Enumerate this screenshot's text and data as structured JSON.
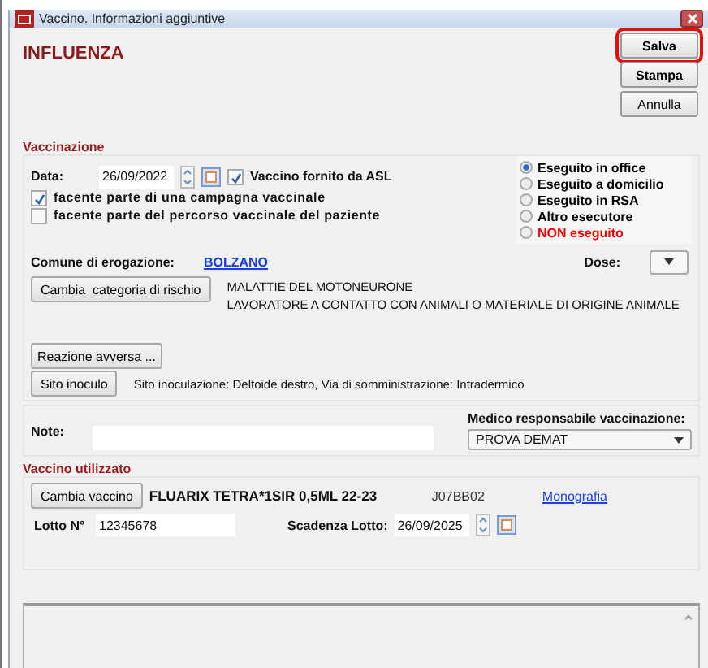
{
  "window": {
    "title": "Vaccino. Informazioni aggiuntive"
  },
  "heading": "INFLUENZA",
  "buttons": [
    {
      "label": "Salva",
      "highlighted": true
    },
    {
      "label": "Stampa",
      "highlighted": false
    },
    {
      "label": "Annulla",
      "highlighted": false
    }
  ],
  "vaccinazione": {
    "title": "Vaccinazione",
    "date_label": "Data:",
    "date": "26/09/2022",
    "asl": {
      "label": "Vaccino fornito da ASL",
      "checked": true
    },
    "checkboxes": [
      {
        "label": "facente parte di una campagna vaccinale",
        "checked": true
      },
      {
        "label": "facente parte del percorso vaccinale del paziente",
        "checked": false
      }
    ],
    "executor_options": [
      {
        "label": "Eseguito in office",
        "selected": true,
        "color": "#000000"
      },
      {
        "label": "Eseguito a domicilio",
        "selected": false,
        "color": "#000000"
      },
      {
        "label": "Eseguito in RSA",
        "selected": false,
        "color": "#000000"
      },
      {
        "label": "Altro esecutore",
        "selected": false,
        "color": "#000000"
      },
      {
        "label": "NON eseguito",
        "selected": false,
        "color": "#ff0000"
      }
    ],
    "comune_label": "Comune di erogazione:",
    "comune": "BOLZANO",
    "dose_label": "Dose:",
    "risk_button": "Cambia  categoria di rischio",
    "risk_lines": [
      "MALATTIE DEL MOTONEURONE",
      "LAVORATORE A CONTATTO CON ANIMALI O MATERIALE DI ORIGINE ANIMALE"
    ],
    "reaction_button": "Reazione avversa ...",
    "site_button": "Sito inoculo",
    "site_text": "Sito inoculazione: Deltoide destro, Via di somministrazione: Intradermico",
    "note_label": "Note:",
    "doctor_label": "Medico responsabile vaccinazione:",
    "doctor": "PROVA DEMAT"
  },
  "vaccino": {
    "title": "Vaccino utilizzato",
    "change_button": "Cambia vaccino",
    "name": "FLUARIX TETRA*1SIR 0,5ML 22-23",
    "code": "J07BB02",
    "link": "Monografia",
    "lot_label": "Lotto N°",
    "lot": "12345678",
    "expiry_label": "Scadenza Lotto:",
    "expiry": "26/09/2025"
  }
}
